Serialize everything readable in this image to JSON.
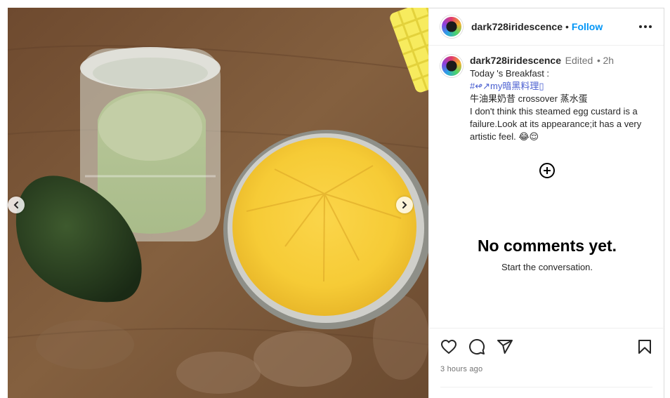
{
  "post": {
    "username": "dark728iridescence",
    "follow_label": "Follow",
    "separator": "•"
  },
  "caption": {
    "username": "dark728iridescence",
    "edited": "Edited",
    "separator": "•",
    "time": "2h",
    "line1": "Today 's Breakfast :",
    "hashtag": "#↫↗my暗黑料理▯",
    "line3": "牛油果奶昔 crossover 蒸水蛋",
    "line4": "I don't think this steamed egg custard is a failure.Look at its appearance;it has a very artistic feel. 😂😌"
  },
  "comments": {
    "empty_title": "No comments yet.",
    "empty_subtitle": "Start the conversation."
  },
  "footer": {
    "timestamp": "3 hours ago"
  },
  "icons": {
    "prev": "chevron-left-icon",
    "next": "chevron-right-icon",
    "more": "more-options-icon",
    "add": "add-circle-icon",
    "like": "heart-icon",
    "comment": "comment-icon",
    "share": "paper-plane-icon",
    "save": "bookmark-icon"
  },
  "colors": {
    "follow": "#0095f6",
    "muted": "#737373",
    "hashtag": "#4a5fd0"
  }
}
